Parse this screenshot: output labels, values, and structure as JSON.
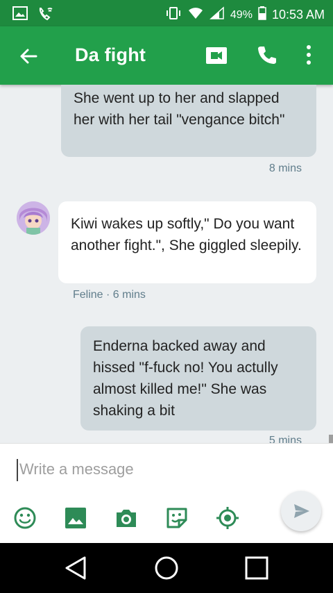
{
  "status_bar": {
    "battery": "49%",
    "time": "10:53 AM",
    "icons": [
      "image-icon",
      "wifi-call-icon",
      "vibrate-icon",
      "wifi-icon",
      "signal-icon",
      "battery-icon"
    ]
  },
  "app_bar": {
    "title": "Da fight",
    "icons": [
      "back-arrow-icon",
      "video-call-icon",
      "phone-icon",
      "more-vert-icon"
    ]
  },
  "messages": [
    {
      "direction": "outgoing",
      "text": "She went up to her and slapped her with her tail \"vengance bitch\"",
      "meta": "8 mins"
    },
    {
      "direction": "incoming",
      "text": "Kiwi wakes up softly,\" Do you want another fight.\", She giggled sleepily.",
      "meta": "Feline · 6 mins"
    },
    {
      "direction": "outgoing",
      "text": "Enderna backed away and hissed \"f-fuck no! You actully almost killed me!\" She was shaking a bit",
      "meta": "5 mins"
    }
  ],
  "composer": {
    "placeholder": "Write a message",
    "tools": [
      "emoji-icon",
      "image-icon",
      "camera-icon",
      "sticker-icon",
      "location-icon",
      "send-icon"
    ]
  },
  "colors": {
    "status_bar": "#1e8a3e",
    "app_bar": "#22a04b",
    "outgoing_bubble": "#cfd8dc",
    "incoming_bubble": "#ffffff",
    "background": "#eceff1"
  }
}
